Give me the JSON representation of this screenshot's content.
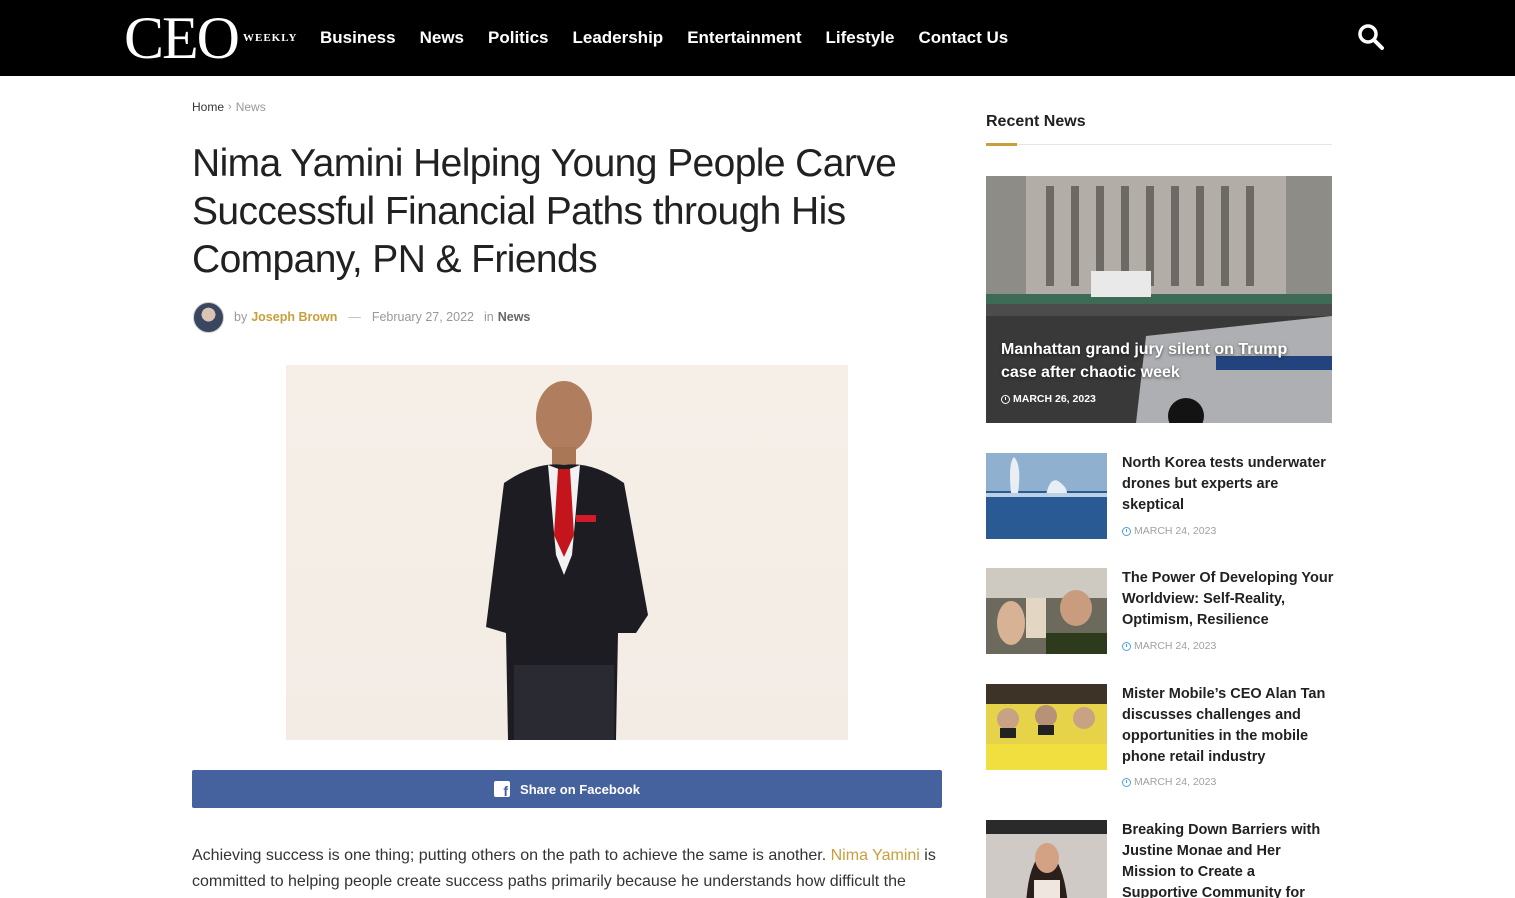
{
  "header": {
    "logo_main": "CEO",
    "logo_sub": "WEEKLY",
    "nav": [
      "Business",
      "News",
      "Politics",
      "Leadership",
      "Entertainment",
      "Lifestyle",
      "Contact Us"
    ],
    "search_icon": "search-icon"
  },
  "breadcrumb": {
    "home": "Home",
    "current": "News"
  },
  "article": {
    "title": "Nima Yamini Helping Young People Carve Successful Financial Paths through His Company, PN & Friends",
    "by_label": "by",
    "author": "Joseph Brown",
    "dash": "—",
    "date": "February 27, 2022",
    "in_label": "in",
    "category": "News",
    "share_label": "Share on Facebook",
    "body_before": "Achieving success is one thing; putting others on the path to achieve the same is another. ",
    "body_link": "Nima Yamini",
    "body_after": " is committed to helping people create success paths primarily because he understands how difficult the"
  },
  "sidebar": {
    "heading": "Recent News",
    "featured": {
      "title": "Manhattan grand jury silent on Trump case after chaotic week",
      "date": "MARCH 26, 2023"
    },
    "items": [
      {
        "title": "North Korea tests underwater drones but experts are skeptical",
        "date": "MARCH 24, 2023"
      },
      {
        "title": "The Power Of Developing Your Worldview: Self-Reality, Optimism, Resilience",
        "date": "MARCH 24, 2023"
      },
      {
        "title": "Mister Mobile’s CEO Alan Tan discusses challenges and opportunities in the mobile phone retail industry",
        "date": "MARCH 24, 2023"
      },
      {
        "title": "Breaking Down Barriers with Justine Monae and Her Mission to Create a Supportive Community for Women",
        "date": ""
      }
    ]
  },
  "colors": {
    "accent": "#c8a03b",
    "facebook": "#45629f",
    "date_icon": "#4aa1df"
  }
}
